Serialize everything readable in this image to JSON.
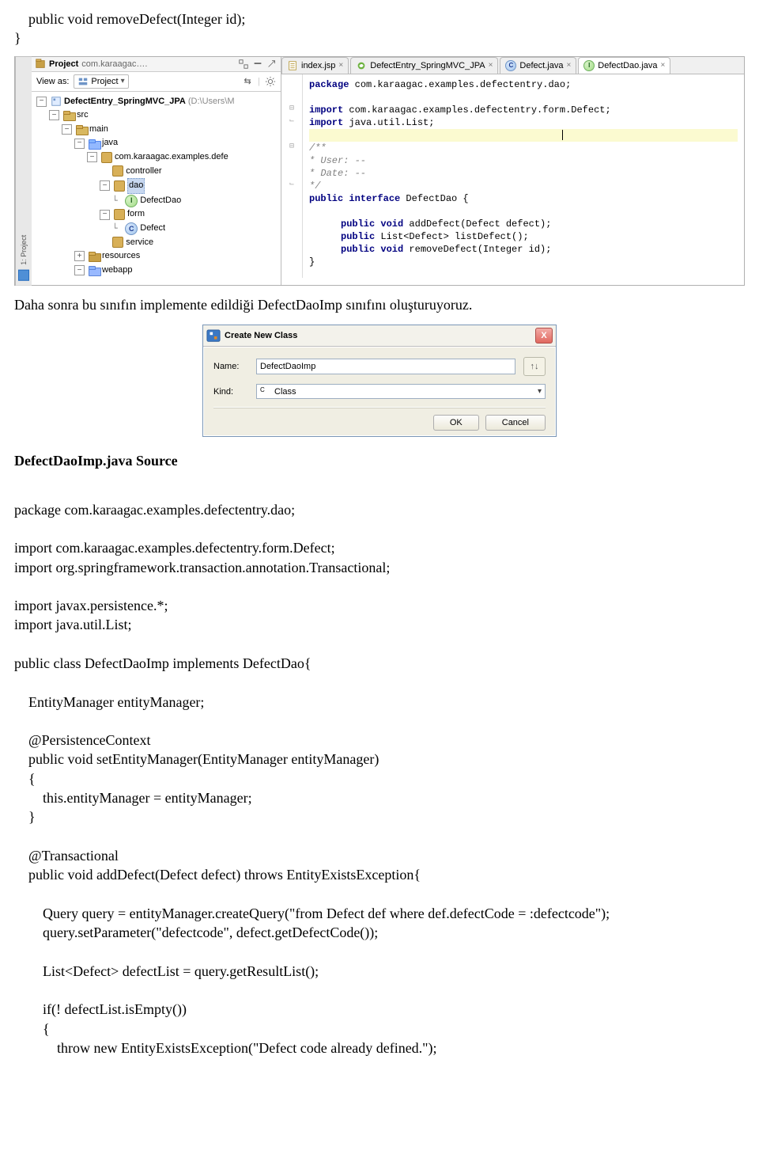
{
  "top_code": "    public void removeDefect(Integer id);\n}",
  "paragraph1": "Daha sonra bu sınıfın implemente edildiği DefectDaoImp sınıfını oluşturuyoruz.",
  "heading2": "DefectDaoImp.java Source",
  "java_source": {
    "line1": "package com.karaagac.examples.defectentry.dao;",
    "blank1": "",
    "line2": "import com.karaagac.examples.defectentry.form.Defect;",
    "line3": "import org.springframework.transaction.annotation.Transactional;",
    "blank2": "",
    "line4": "import javax.persistence.*;",
    "line5": "import java.util.List;",
    "blank3": "",
    "line6": "public class DefectDaoImp implements DefectDao{",
    "blank4": "",
    "line7": "    EntityManager entityManager;",
    "blank5": "",
    "line8": "    @PersistenceContext",
    "line9": "    public void setEntityManager(EntityManager entityManager)",
    "line10": "    {",
    "line11": "        this.entityManager = entityManager;",
    "line12": "    }",
    "blank6": "",
    "line13": "    @Transactional",
    "line14": "    public void addDefect(Defect defect) throws EntityExistsException{",
    "blank7": "",
    "line15": "        Query query = entityManager.createQuery(\"from Defect def where def.defectCode = :defectcode\");",
    "line16": "        query.setParameter(\"defectcode\", defect.getDefectCode());",
    "blank8": "",
    "line17": "        List<Defect> defectList = query.getResultList();",
    "blank9": "",
    "line18": "        if(! defectList.isEmpty())",
    "line19": "        {",
    "line20": "            throw new EntityExistsException(\"Defect code already defined.\");"
  },
  "ide": {
    "gutter_label": "1: Project",
    "header": {
      "title_prefix": "Project",
      "title_project": "com.karaagac…."
    },
    "toolbar": {
      "view_as": "View as:",
      "view_value": "Project"
    },
    "tree": {
      "root": "DefectEntry_SpringMVC_JPA",
      "root_suffix": "(D:\\Users\\M",
      "src": "src",
      "main": "main",
      "java": "java",
      "pkg": "com.karaagac.examples.defe",
      "controller": "controller",
      "dao": "dao",
      "defectdao": "DefectDao",
      "form": "form",
      "defect": "Defect",
      "service": "service",
      "resources": "resources",
      "webapp": "webapp"
    },
    "tabs": {
      "t1": "index.jsp",
      "t2": "DefectEntry_SpringMVC_JPA",
      "t3": "Defect.java",
      "t4": "DefectDao.java"
    },
    "editor": {
      "l1_pkg": "package",
      "l1_rest": " com.karaagac.examples.defectentry.dao;",
      "l2_imp": "import",
      "l2_rest": " com.karaagac.examples.defectentry.form.Defect;",
      "l3_imp": "import",
      "l3_rest": " java.util.List;",
      "c1": "/**",
      "c2": " * User: --",
      "c3": " * Date: --",
      "c4": " */",
      "d1a": "public interface",
      "d1b": " DefectDao {",
      "m1a": "public void",
      "m1b": " addDefect(Defect defect);",
      "m2a": "public",
      "m2b": " List<Defect> listDefect();",
      "m3a": "public void",
      "m3b": " removeDefect(Integer id);",
      "close": "}"
    }
  },
  "dialog": {
    "title": "Create New Class",
    "name_label": "Name:",
    "name_value": "DefectDaoImp",
    "updown": "↑↓",
    "kind_label": "Kind:",
    "kind_value": "Class",
    "ok": "OK",
    "cancel": "Cancel"
  }
}
